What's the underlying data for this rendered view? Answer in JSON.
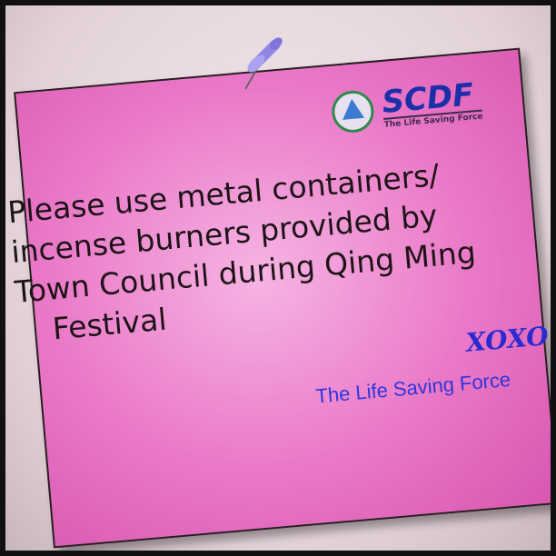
{
  "logo": {
    "brand": "SCDF",
    "tagline": "The Life Saving Force",
    "icon": "scdf-crest-icon"
  },
  "message": {
    "lines": [
      "Please use metal containers/",
      "incense burners provided by",
      "Town Council during Qing Ming",
      "Festival"
    ]
  },
  "signoff": {
    "xoxo": "XOXO",
    "signature": "The Life Saving Force"
  },
  "colors": {
    "note": "#ea78c8",
    "text": "#1e1418",
    "signature": "#2f35d8",
    "brand": "#1b2fa8",
    "pin": "#8f86e6"
  }
}
